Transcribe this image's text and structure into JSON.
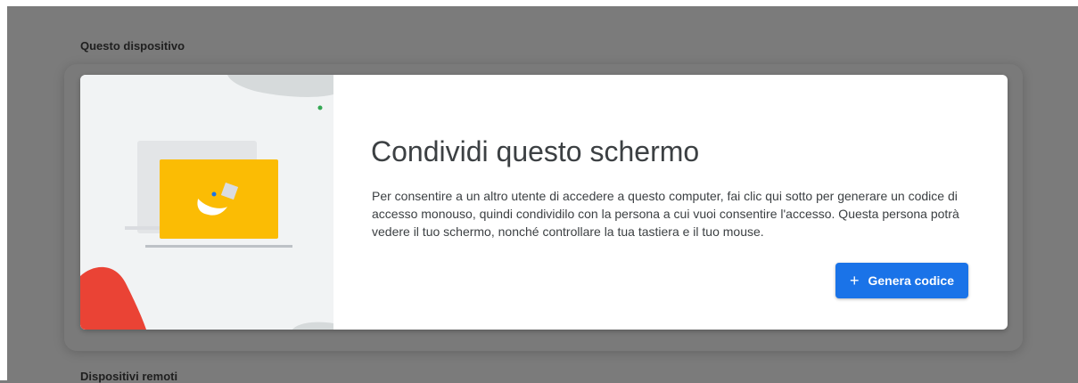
{
  "sections": {
    "this_device": "Questo dispositivo",
    "remote_devices": "Dispositivi remoti"
  },
  "share_card": {
    "title": "Condividi questo schermo",
    "description": "Per consentire a un altro utente di accedere a questo computer, fai clic qui sotto per generare un codice di accesso monouso, quindi condividilo con la persona a cui vuoi consentire l'accesso. Questa persona potrà vedere il tuo schermo, nonché controllare la tua tastiera e il tuo mouse.",
    "button_icon": "+",
    "button_label": "Genera codice"
  },
  "colors": {
    "accent": "#1a73e8",
    "illustration_yellow": "#fbbc04",
    "illustration_red": "#ea4335",
    "illustration_green": "#34a853"
  },
  "icons": [
    "plus-icon",
    "laptop-illustration"
  ]
}
